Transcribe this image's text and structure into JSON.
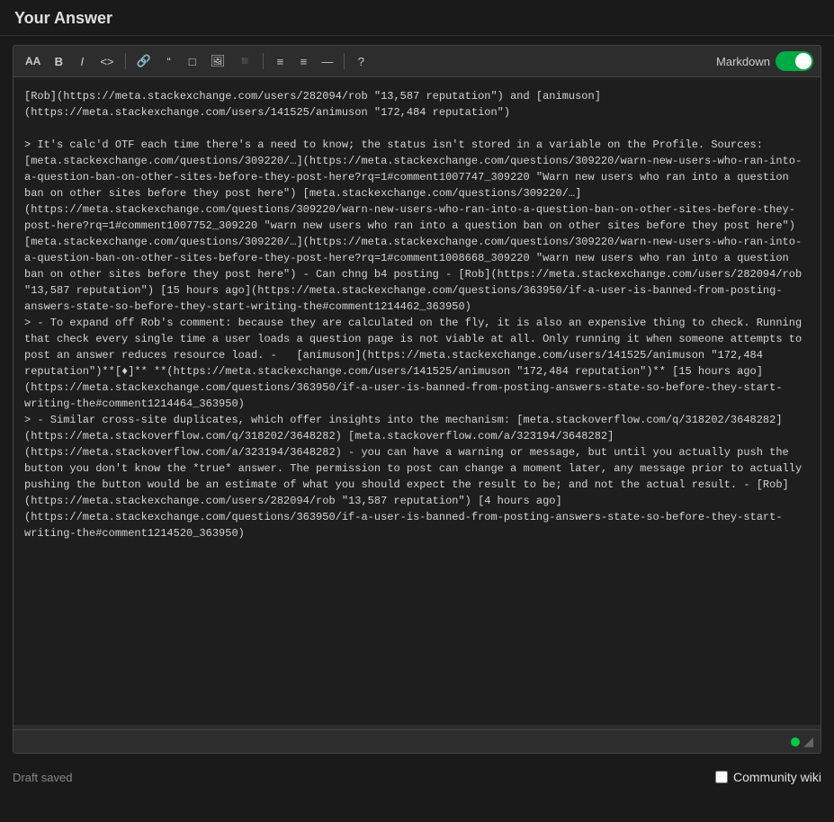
{
  "header": {
    "title": "Your Answer"
  },
  "toolbar": {
    "buttons": [
      {
        "name": "font-size",
        "label": "AA"
      },
      {
        "name": "bold",
        "label": "B"
      },
      {
        "name": "italic",
        "label": "I"
      },
      {
        "name": "code",
        "label": "<>"
      },
      {
        "name": "link",
        "label": "🔗"
      },
      {
        "name": "blockquote",
        "label": "\""
      },
      {
        "name": "image",
        "label": "⊡"
      },
      {
        "name": "photo",
        "label": "🖼"
      },
      {
        "name": "table",
        "label": "⊞"
      },
      {
        "name": "ordered-list",
        "label": "≡"
      },
      {
        "name": "unordered-list",
        "label": "≡"
      },
      {
        "name": "horizontal-rule",
        "label": "—"
      },
      {
        "name": "help",
        "label": "?"
      }
    ],
    "markdown_label": "Markdown",
    "markdown_enabled": true
  },
  "editor": {
    "content": "[Rob](https://meta.stackexchange.com/users/282094/rob \"13,587 reputation\") and [animuson](https://meta.stackexchange.com/users/141525/animuson \"172,484 reputation\")\n\n> It's calc'd OTF each time there's a need to know; the status isn't stored in a variable on the Profile. Sources: [meta.stackexchange.com/questions/309220/…](https://meta.stackexchange.com/questions/309220/warn-new-users-who-ran-into-a-question-ban-on-other-sites-before-they-post-here?rq=1#comment1007747_309220 \"Warn new users who ran into a question ban on other sites before they post here\") [meta.stackexchange.com/questions/309220/…](https://meta.stackexchange.com/questions/309220/warn-new-users-who-ran-into-a-question-ban-on-other-sites-before-they-post-here?rq=1#comment1007752_309220 \"warn new users who ran into a question ban on other sites before they post here\") [meta.stackexchange.com/questions/309220/…](https://meta.stackexchange.com/questions/309220/warn-new-users-who-ran-into-a-question-ban-on-other-sites-before-they-post-here?rq=1#comment1008668_309220 \"warn new users who ran into a question ban on other sites before they post here\") - Can chng b4 posting - [Rob](https://meta.stackexchange.com/users/282094/rob \"13,587 reputation\") [15 hours ago](https://meta.stackexchange.com/questions/363950/if-a-user-is-banned-from-posting-answers-state-so-before-they-start-writing-the#comment1214462_363950)\n> - To expand off Rob's comment: because they are calculated on the fly, it is also an expensive thing to check. Running that check every single time a user loads a question page is not viable at all. Only running it when someone attempts to post an answer reduces resource load. - [animuson](https://meta.stackexchange.com/users/141525/animuson \"172,484 reputation\")**[♦]** **(https://meta.stackexchange.com/users/141525/animuson \"172,484 reputation\")** [15 hours ago](https://meta.stackexchange.com/questions/363950/if-a-user-is-banned-from-posting-answers-state-so-before-they-start-writing-the#comment1214464_363950)\n> - Similar cross-site duplicates, which offer insights into the mechanism: [meta.stackoverflow.com/q/318202/3648282](https://meta.stackoverflow.com/q/318202/3648282) [meta.stackoverflow.com/a/323194/3648282](https://meta.stackoverflow.com/a/323194/3648282) - you can have a warning or message, but until you actually push the button you don't know the *true* answer. The permission to post can change a moment later, any message prior to actually pushing the button would be an estimate of what you should expect the result to be; and not the actual result. - [Rob](https://meta.stackexchange.com/users/282094/rob \"13,587 reputation\") [4 hours ago](https://meta.stackexchange.com/questions/363950/if-a-user-is-banned-from-posting-answers-state-so-before-they-start-writing-the#comment1214520_363950)"
  },
  "footer": {
    "draft_saved": "Draft saved",
    "community_wiki_label": "Community wiki"
  }
}
